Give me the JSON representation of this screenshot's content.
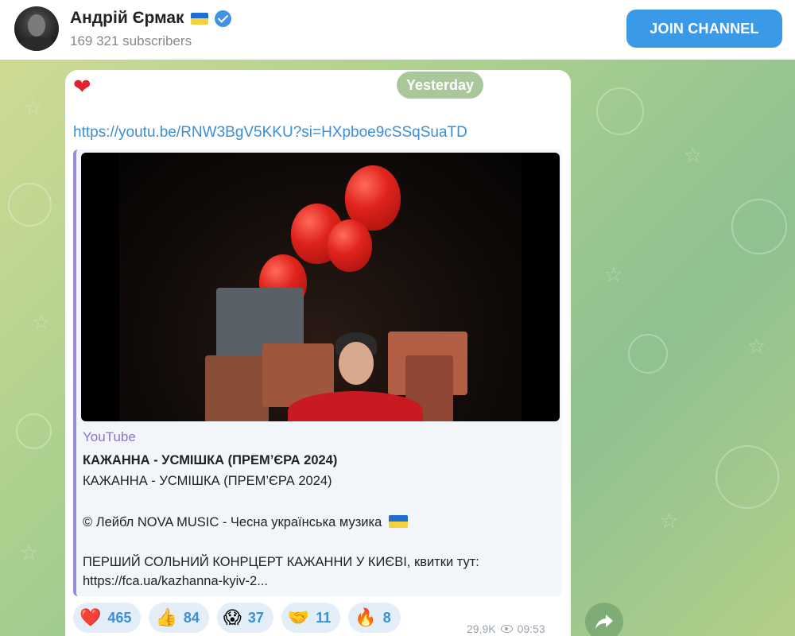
{
  "header": {
    "channel_name": "Андрій Єрмак",
    "subscribers": "169 321 subscribers",
    "join_label": "JOIN CHANNEL"
  },
  "message": {
    "date": "Yesterday",
    "link": "https://youtu.be/RNW3BgV5KKU?si=HXpboe9cSSqSuaTD",
    "preview": {
      "source": "YouTube",
      "title": "КАЖАННА - УСМІШКА (ПРЕМ’ЄРА 2024)",
      "line1": "КАЖАННА - УСМІШКА (ПРЕМ’ЄРА 2024)",
      "line2": "© Лейбл NOVA MUSIC - Чесна українська музика",
      "line3": "ПЕРШИЙ СОЛЬНИЙ КОНРЦЕРТ КАЖАННИ У КИЄВІ, квитки тут:",
      "line4": "https://fca.ua/kazhanna-kyiv-2..."
    },
    "reactions": [
      {
        "emoji": "❤️",
        "count": "465",
        "icon": "red-heart-icon"
      },
      {
        "emoji": "👍",
        "count": "84",
        "icon": "thumbs-up-icon"
      },
      {
        "emoji": "😱",
        "count": "37",
        "icon": "screaming-face-icon"
      },
      {
        "emoji": "🤝",
        "count": "11",
        "icon": "handshake-icon"
      },
      {
        "emoji": "🔥",
        "count": "8",
        "icon": "fire-icon"
      }
    ],
    "views": "29,9K",
    "time": "09:53"
  },
  "colors": {
    "accent": "#3b9ae8",
    "link": "#3a8fd6",
    "preview_bar": "#9a8cd8"
  }
}
